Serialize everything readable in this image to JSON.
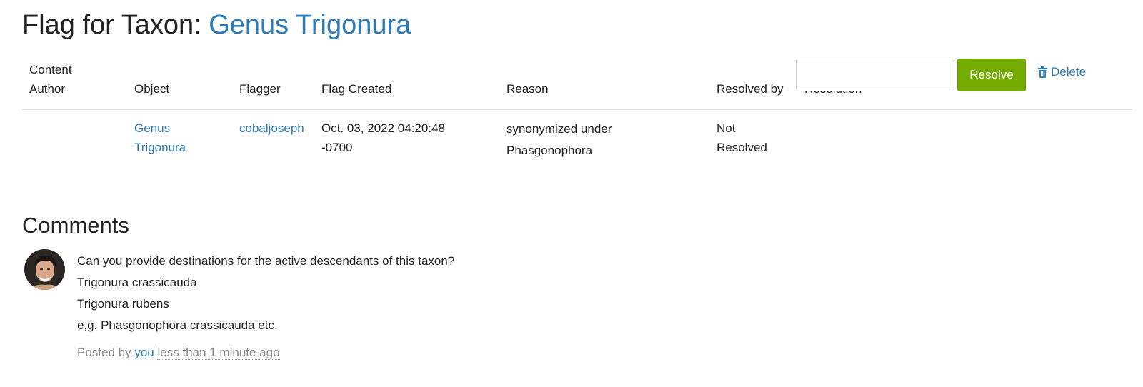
{
  "header": {
    "title_prefix": "Flag for Taxon: ",
    "taxon_name": "Genus Trigonura"
  },
  "table": {
    "columns": {
      "content_author_line1": "Content",
      "content_author_line2": "Author",
      "object": "Object",
      "flagger": "Flagger",
      "flag_created": "Flag Created",
      "reason": "Reason",
      "resolved_by": "Resolved by",
      "resolution": "Resolution"
    },
    "row": {
      "content_author": "",
      "object_line1": "Genus",
      "object_line2": "Trigonura",
      "flagger": "cobaljoseph",
      "created_line1": "Oct. 03, 2022 04:20:48",
      "created_line2": "-0700",
      "reason_line1": "synonymized under",
      "reason_line2": "Phasgonophora",
      "resolved_line1": "Not",
      "resolved_line2": "Resolved",
      "resolution_value": "",
      "resolve_label": "Resolve",
      "delete_label": "Delete"
    }
  },
  "comments": {
    "title": "Comments",
    "items": [
      {
        "lines": [
          "Can you provide destinations for the active descendants of this taxon?",
          "Trigonura crassicauda",
          "Trigonura rubens",
          "e,g. Phasgonophora crassicauda etc."
        ],
        "posted_prefix": "Posted by ",
        "author": "you",
        "time": "less than 1 minute ago"
      }
    ]
  },
  "colors": {
    "link": "#2b7bb9",
    "resolve_button": "#74ac00",
    "muted_text": "#888888"
  },
  "icons": {
    "delete": "trash-icon",
    "avatar": "user-avatar"
  }
}
